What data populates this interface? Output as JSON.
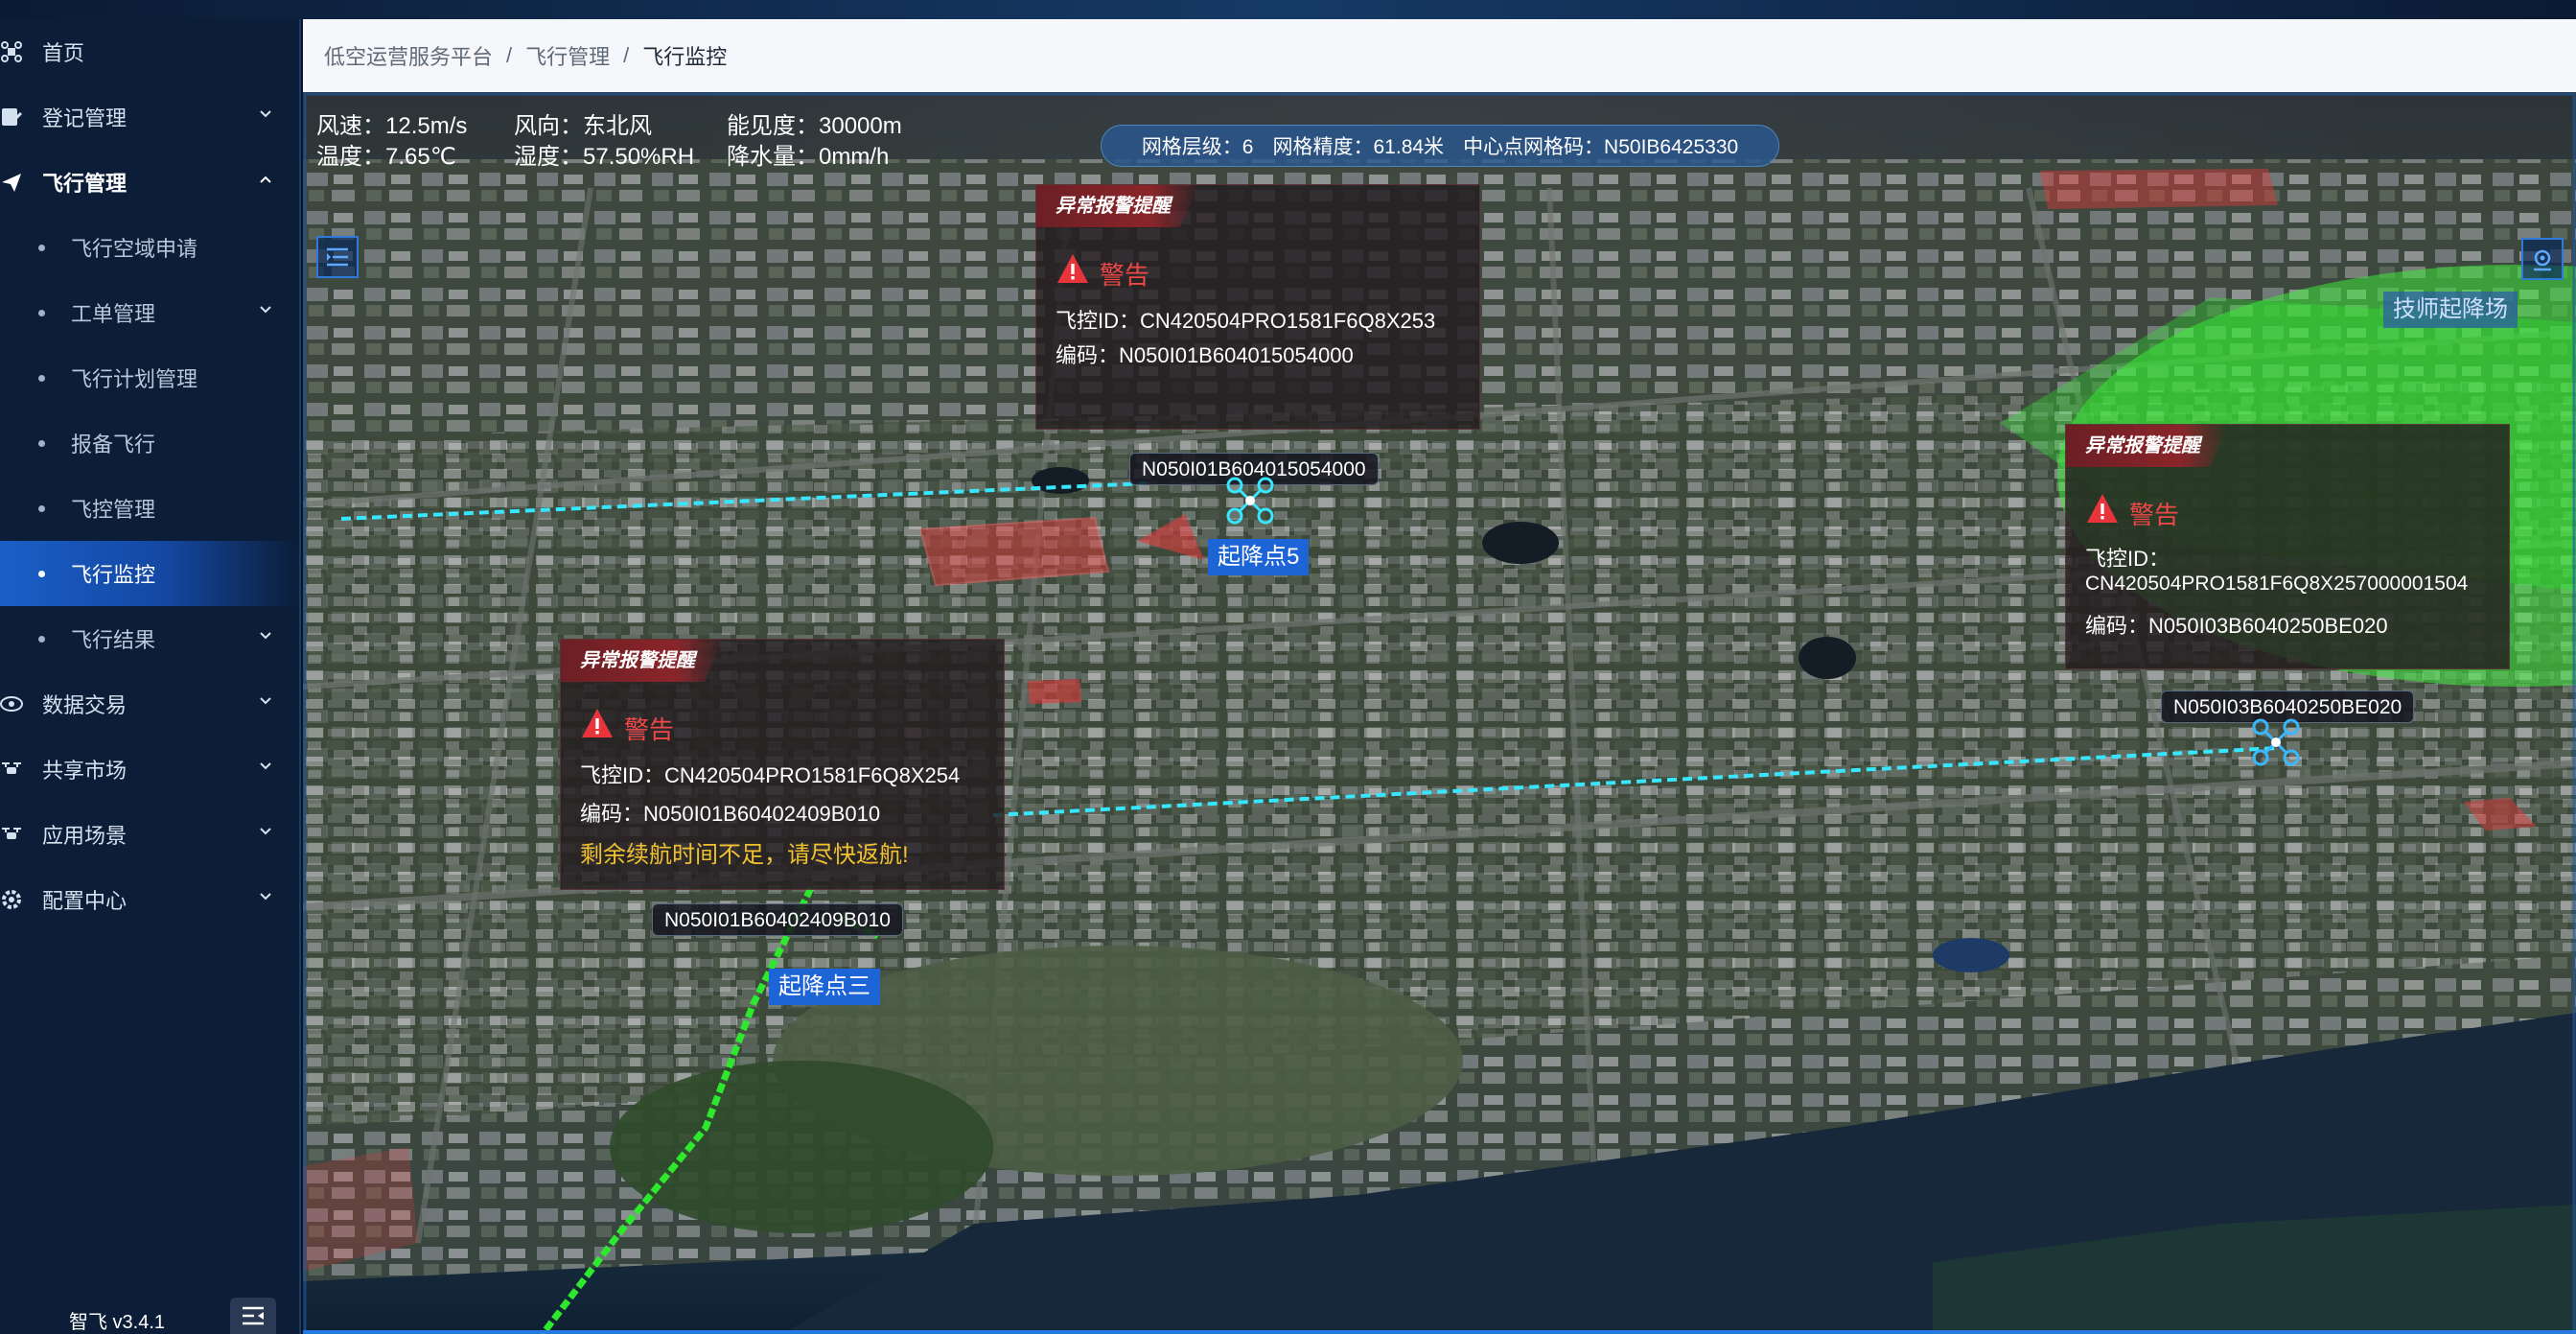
{
  "sidebar": {
    "items": [
      {
        "label": "首页",
        "icon": "drone-home-icon",
        "arrow": ""
      },
      {
        "label": "登记管理",
        "icon": "register-icon",
        "arrow": "down"
      },
      {
        "label": "飞行管理",
        "icon": "plane-icon",
        "arrow": "up"
      },
      {
        "label": "飞行空域申请"
      },
      {
        "label": "工单管理",
        "arrow": "down"
      },
      {
        "label": "飞行计划管理"
      },
      {
        "label": "报备飞行"
      },
      {
        "label": "飞控管理"
      },
      {
        "label": "飞行监控"
      },
      {
        "label": "飞行结果",
        "arrow": "down"
      },
      {
        "label": "数据交易",
        "icon": "eye-icon",
        "arrow": "down"
      },
      {
        "label": "共享市场",
        "icon": "drone-icon",
        "arrow": "down"
      },
      {
        "label": "应用场景",
        "icon": "drone-icon",
        "arrow": "down"
      },
      {
        "label": "配置中心",
        "icon": "gear-icon",
        "arrow": "down"
      }
    ],
    "version": "智飞 v3.4.1"
  },
  "breadcrumb": {
    "items": [
      "低空运营服务平台",
      "飞行管理",
      "飞行监控"
    ],
    "separator": "/"
  },
  "weather": {
    "wind_speed": "风速：12.5m/s",
    "wind_dir": "风向：东北风",
    "visibility": "能见度：30000m",
    "temperature": "温度：7.65℃",
    "humidity": "湿度：57.50%RH",
    "precipitation": "降水量：0mm/h"
  },
  "grid_info": {
    "level": "网格层级：6",
    "precision": "网格精度：61.84米",
    "center_code": "中心点网格码：N50IB6425330"
  },
  "alarms": [
    {
      "header": "异常报警提醒",
      "title": "警告",
      "fc_id": "飞控ID：CN420504PRO1581F6Q8X253",
      "code": "编码：N050I01B604015054000"
    },
    {
      "header": "异常报警提醒",
      "title": "警告",
      "fc_id": "飞控ID：CN420504PRO1581F6Q8X254",
      "code": "编码：N050I01B60402409B010",
      "note": "剩余续航时间不足，请尽快返航!"
    },
    {
      "header": "异常报警提醒",
      "title": "警告",
      "fc_id_label": "飞控ID：",
      "fc_id_value": "CN420504PRO1581F6Q8X257000001504",
      "code": "编码：N050I03B6040250BE020"
    }
  ],
  "drone_tags": [
    "N050I01B604015054000",
    "N050I01B60402409B010",
    "N050I03B6040250BE020"
  ],
  "sites": [
    "起降点5",
    "起降点三",
    "技师起降场"
  ],
  "colors": {
    "sidebar_bg": "#0c1d38",
    "active_item": "#1a5fc7",
    "alarm_red": "#f04848",
    "warning_yellow": "#f2c12e",
    "route_cyan": "#39e6ff",
    "route_green": "#2ee82e",
    "zone_green": "#3ee83a",
    "zone_red": "#e03a3a"
  }
}
